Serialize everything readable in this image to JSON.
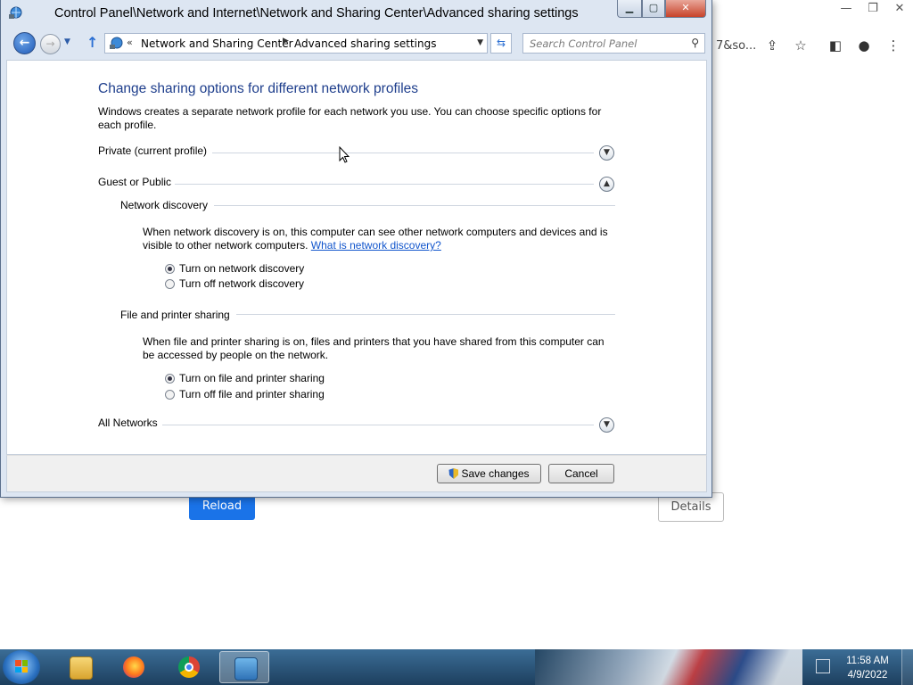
{
  "browser": {
    "url_fragment": "7&so...",
    "reload_label": "Reload",
    "details_label": "Details",
    "accent_color": "#1a73e8"
  },
  "window": {
    "title": "Control Panel\\Network and Internet\\Network and Sharing Center\\Advanced sharing settings",
    "address": {
      "chevron": "«",
      "crumbs": [
        "Network and Sharing Center",
        "Advanced sharing settings"
      ]
    },
    "search_placeholder": "Search Control Panel"
  },
  "page": {
    "heading": "Change sharing options for different network profiles",
    "intro": "Windows creates a separate network profile for each network you use. You can choose specific options for each profile.",
    "profiles": {
      "private": "Private (current profile)",
      "guest_public": "Guest or Public",
      "all_networks": "All Networks"
    },
    "network_discovery": {
      "title": "Network discovery",
      "description": "When network discovery is on, this computer can see other network computers and devices and is visible to other network computers.",
      "link": "What is network discovery?",
      "options": [
        "Turn on network discovery",
        "Turn off network discovery"
      ],
      "selected": 0
    },
    "file_printer_sharing": {
      "title": "File and printer sharing",
      "description": "When file and printer sharing is on, files and printers that you have shared from this computer can be accessed by people on the network.",
      "options": [
        "Turn on file and printer sharing",
        "Turn off file and printer sharing"
      ],
      "selected": 0
    }
  },
  "buttons": {
    "save": "Save changes",
    "cancel": "Cancel"
  },
  "taskbar": {
    "items": [
      "windows-explorer",
      "firefox",
      "chrome",
      "control-panel"
    ],
    "clock_time": "11:58 AM",
    "clock_date": "4/9/2022"
  }
}
